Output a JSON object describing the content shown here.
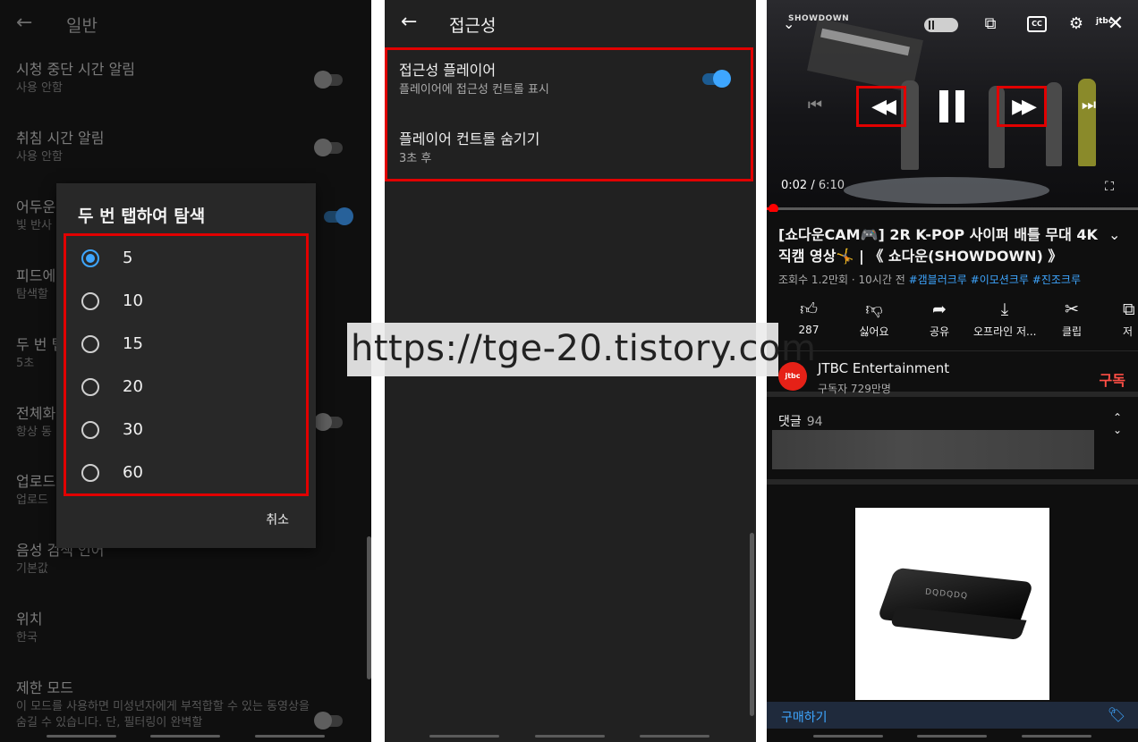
{
  "panel1": {
    "title": "일반",
    "rows": [
      {
        "title": "시청 중단 시간 알림",
        "sub": "사용 안함"
      },
      {
        "title": "취침 시간 알림",
        "sub": "사용 안함"
      },
      {
        "title": "어두운",
        "sub": "빛 반사"
      },
      {
        "title": "피드에",
        "sub": "탐색할"
      },
      {
        "title": "두 번 탭",
        "sub": "5초"
      },
      {
        "title": "전체화",
        "sub": "항상 동"
      },
      {
        "title": "업로드",
        "sub": "업로드"
      },
      {
        "title": "음성 검색 언어",
        "sub": "기본값"
      },
      {
        "title": "위치",
        "sub": "한국"
      },
      {
        "title": "제한 모드",
        "sub": "이 모드를 사용하면 미성년자에게 부적합할 수 있는 동영상을 숨길 수 있습니다. 단, 필터링이 완벽할"
      }
    ],
    "dialog": {
      "title": "두 번 탭하여 탐색",
      "options": [
        "5",
        "10",
        "15",
        "20",
        "30",
        "60"
      ],
      "selected": "5",
      "cancel": "취소"
    }
  },
  "panel2": {
    "title": "접근성",
    "rows": [
      {
        "title": "접근성 플레이어",
        "sub": "플레이어에 접근성 컨트롤 표시",
        "toggle": true
      },
      {
        "title": "플레이어 컨트롤 숨기기",
        "sub": "3초 후"
      }
    ]
  },
  "watermark": "https://tge-20.tistory.com",
  "panel3": {
    "player": {
      "brand": "SHOWDOWN",
      "jtbc": "jtbc",
      "cc": "CC",
      "current_time": "0:02",
      "duration": "6:10",
      "progress_fraction": 0.005
    },
    "video_title": "[쇼다운CAM🎮] 2R K-POP 사이퍼 배틀 무대 4K 직캠 영상🤸 | 《 쇼다운(SHOWDOWN) 》",
    "meta_plain": "조회수 1.2만회 · 10시간 전",
    "hashtags": [
      "#갬블러크루",
      "#이모션크루",
      "#진조크루"
    ],
    "actions": [
      {
        "icon": "thumbs-up-icon",
        "label": "287"
      },
      {
        "icon": "thumbs-down-icon",
        "label": "싫어요"
      },
      {
        "icon": "share-icon",
        "label": "공유"
      },
      {
        "icon": "download-icon",
        "label": "오프라인 저..."
      },
      {
        "icon": "scissors-icon",
        "label": "클립"
      },
      {
        "icon": "save-icon",
        "label": "저"
      }
    ],
    "channel": {
      "avatar_text": "jtbc",
      "name": "JTBC Entertainment",
      "subs": "구독자 729만명",
      "subscribe": "구독"
    },
    "comments": {
      "label": "댓글",
      "count": "94"
    },
    "ad": {
      "product_brand": "DQDQDQ",
      "buy_label": "구매하기"
    }
  },
  "colors": {
    "accent_blue": "#3ea6ff",
    "highlight_red": "#e10000",
    "subscribe_red": "#ff4e45"
  }
}
